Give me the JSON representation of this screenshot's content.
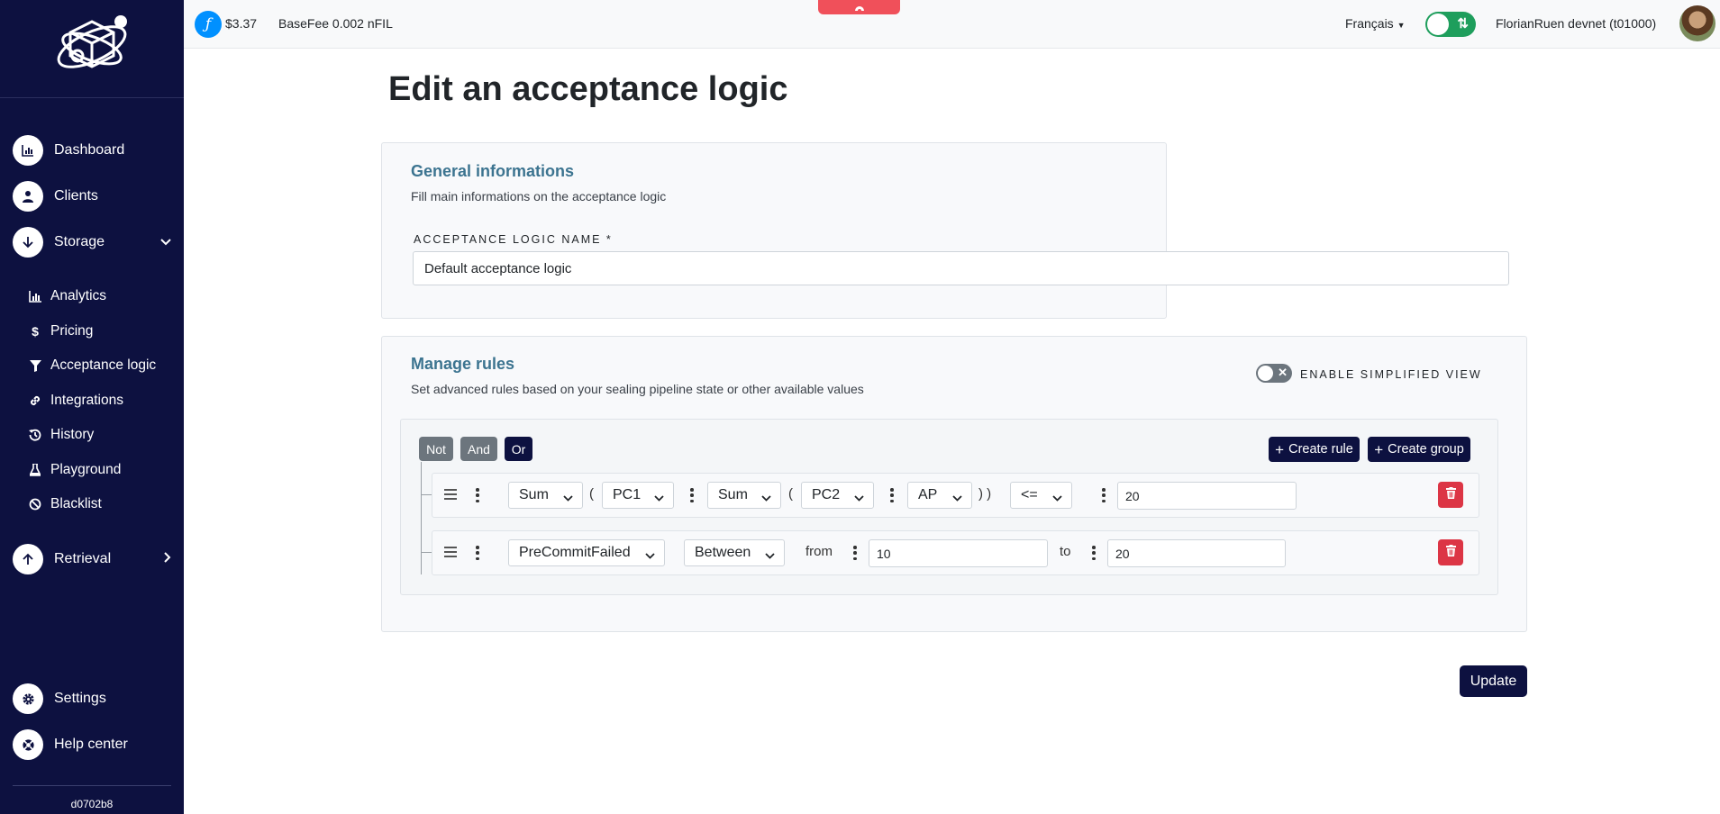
{
  "sidebar": {
    "main_items": [
      {
        "label": "Dashboard",
        "icon": "chart-bar-icon"
      },
      {
        "label": "Clients",
        "icon": "user-icon"
      },
      {
        "label": "Storage",
        "icon": "arrow-down-icon"
      }
    ],
    "storage_sub_items": [
      {
        "label": "Analytics",
        "icon": "chart-icon"
      },
      {
        "label": "Pricing",
        "icon": "dollar-icon"
      },
      {
        "label": "Acceptance logic",
        "icon": "filter-icon"
      },
      {
        "label": "Integrations",
        "icon": "link-icon"
      },
      {
        "label": "History",
        "icon": "history-icon"
      },
      {
        "label": "Playground",
        "icon": "flask-icon"
      },
      {
        "label": "Blacklist",
        "icon": "ban-icon"
      }
    ],
    "retrieval": {
      "label": "Retrieval",
      "icon": "arrow-up-icon"
    },
    "bottom_items": [
      {
        "label": "Settings",
        "icon": "gear-icon"
      },
      {
        "label": "Help center",
        "icon": "lifebuoy-icon"
      }
    ],
    "version": "d0702b8"
  },
  "topbar": {
    "fil_price": "$3.37",
    "base_fee": "BaseFee 0.002 nFIL",
    "language": "Français",
    "user": "FlorianRuen devnet (t01000)"
  },
  "page": {
    "title": "Edit an acceptance logic"
  },
  "general": {
    "title": "General informations",
    "description": "Fill main informations on the acceptance logic",
    "name_label": "ACCEPTANCE LOGIC NAME *",
    "name_value": "Default acceptance logic"
  },
  "rules": {
    "title": "Manage rules",
    "description": "Set advanced rules based on your sealing pipeline state or other available values",
    "simplified_view_label": "ENABLE SIMPLIFIED VIEW",
    "combinators": {
      "not": "Not",
      "and": "And",
      "or": "Or"
    },
    "create_rule": "Create rule",
    "create_group": "Create group",
    "row1": {
      "func1": "Sum",
      "open1": "(",
      "field1": "PC1",
      "func2": "Sum",
      "open2": "(",
      "field2": "PC2",
      "field3": "AP",
      "close": ") )",
      "operator": "<=",
      "value": "20"
    },
    "row2": {
      "field": "PreCommitFailed",
      "operator": "Between",
      "from_label": "from",
      "from_value": "10",
      "to_label": "to",
      "to_value": "20"
    }
  },
  "actions": {
    "update": "Update"
  },
  "colors": {
    "sidebar_bg": "#0d1140",
    "accent_title": "#3c7490",
    "delete_red": "#dc3545",
    "toggle_green": "#1e9e5c"
  }
}
